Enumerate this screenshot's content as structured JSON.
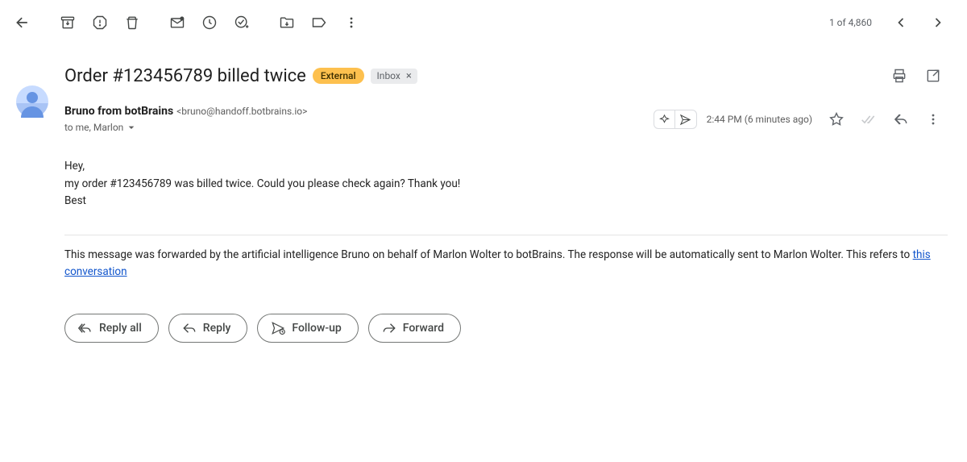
{
  "toolbar": {
    "count_text": "1 of 4,860"
  },
  "subject": "Order #123456789 billed twice",
  "badges": {
    "external": "External",
    "inbox": "Inbox"
  },
  "sender": {
    "name": "Bruno from botBrains",
    "email": "<bruno@handoff.botbrains.io>",
    "to_line": "to me, Marlon"
  },
  "timestamp": "2:44 PM (6 minutes ago)",
  "body": {
    "line1": "Hey,",
    "line2": "my order #123456789 was billed twice. Could you please check again? Thank you!",
    "line3": "Best"
  },
  "footer": {
    "text_before": "This message was forwarded by the artificial intelligence Bruno on behalf of Marlon Wolter to botBrains. The response will be automatically sent to Marlon Wolter. This refers to ",
    "link_text": "this conversation"
  },
  "actions": {
    "reply_all": "Reply all",
    "reply": "Reply",
    "follow_up": "Follow-up",
    "forward": "Forward"
  }
}
